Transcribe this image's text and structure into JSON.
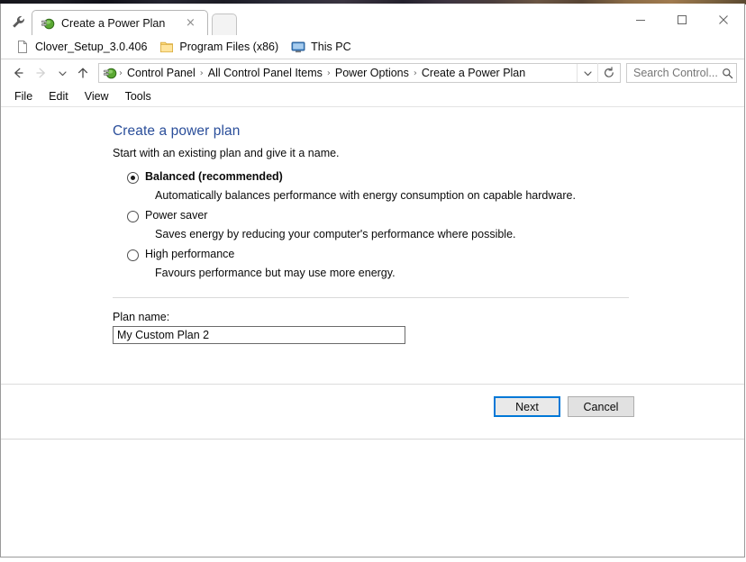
{
  "window": {
    "controls": {
      "minimize": "minimize-icon",
      "maximize": "maximize-icon",
      "close": "close-icon"
    },
    "toolbutton_icon": "wrench-icon"
  },
  "tabs": [
    {
      "title": "Create a Power Plan",
      "favicon": "power-plug-icon",
      "close_label": "×",
      "active": true
    }
  ],
  "new_tab_label": "",
  "favorites_bar": {
    "items": [
      {
        "label": "Clover_Setup_3.0.406",
        "icon": "file-icon"
      },
      {
        "label": "Program Files (x86)",
        "icon": "folder-icon"
      },
      {
        "label": "This PC",
        "icon": "monitor-icon"
      }
    ]
  },
  "navbar": {
    "back_icon": "arrow-left-icon",
    "forward_icon": "arrow-right-icon",
    "history_icon": "chevron-down-icon",
    "up_icon": "arrow-up-icon",
    "address_icon": "power-plug-icon",
    "breadcrumbs": [
      "Control Panel",
      "All Control Panel Items",
      "Power Options",
      "Create a Power Plan"
    ],
    "breadcrumb_separator": "›",
    "dropdown_icon": "chevron-down-icon",
    "refresh_icon": "refresh-icon",
    "search": {
      "placeholder": "Search Control...",
      "value": "",
      "icon": "search-icon"
    }
  },
  "menubar": {
    "items": [
      "File",
      "Edit",
      "View",
      "Tools"
    ]
  },
  "main": {
    "title": "Create a power plan",
    "subtitle": "Start with an existing plan and give it a name.",
    "title_color": "#2a4e9a",
    "plans": [
      {
        "label": "Balanced (recommended)",
        "description": "Automatically balances performance with energy consumption on capable hardware.",
        "selected": true
      },
      {
        "label": "Power saver",
        "description": "Saves energy by reducing your computer's performance where possible.",
        "selected": false
      },
      {
        "label": "High performance",
        "description": "Favours performance but may use more energy.",
        "selected": false
      }
    ],
    "plan_name_label": "Plan name:",
    "plan_name_value": "My Custom Plan 2",
    "plan_name_placeholder": ""
  },
  "buttons": {
    "next": "Next",
    "cancel": "Cancel",
    "focus_color": "#0078d7"
  }
}
